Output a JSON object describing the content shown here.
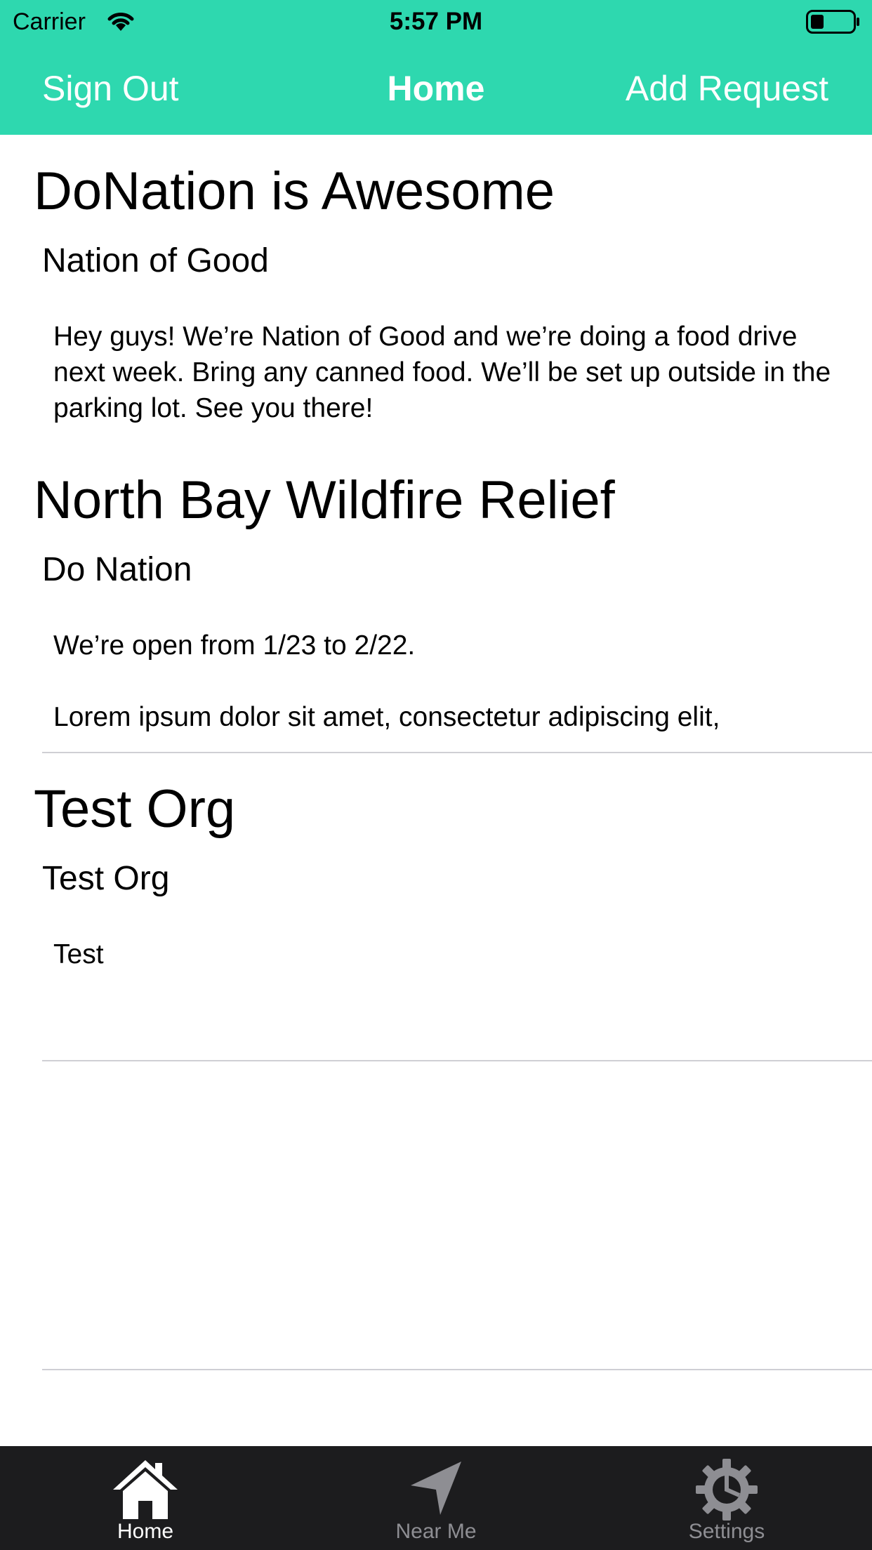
{
  "status_bar": {
    "carrier": "Carrier",
    "time": "5:57 PM",
    "wifi_icon": "wifi-icon",
    "battery_icon": "battery-icon"
  },
  "nav": {
    "left_button": "Sign Out",
    "title": "Home",
    "right_button": "Add Request",
    "background_color": "#2ed8af",
    "text_color": "#ffffff"
  },
  "requests": [
    {
      "title": "DoNation is Awesome",
      "organization": "Nation of Good",
      "description": "Hey guys! We’re Nation of Good and we’re doing a food drive next week. Bring any canned food. We’ll be set up outside in the parking lot. See you there!"
    },
    {
      "title": "North Bay Wildfire Relief",
      "organization": "Do Nation",
      "description": "We’re open from 1/23 to 2/22.\n\nLorem ipsum dolor sit amet, consectetur adipiscing elit,"
    },
    {
      "title": "Test Org",
      "organization": "Test Org",
      "description": "Test"
    }
  ],
  "tab_bar": {
    "background_color": "#1c1c1e",
    "tabs": [
      {
        "label": "Home",
        "icon": "home-icon",
        "active": true
      },
      {
        "label": "Near Me",
        "icon": "location-arrow-icon",
        "active": false
      },
      {
        "label": "Settings",
        "icon": "gear-icon",
        "active": false
      }
    ]
  }
}
